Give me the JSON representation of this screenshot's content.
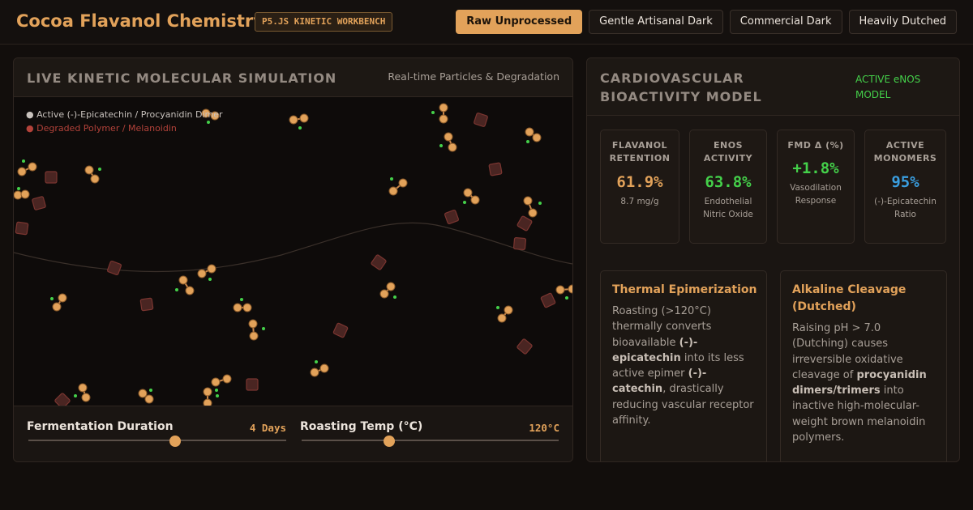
{
  "header": {
    "title": "Cocoa Flavanol Chemistry",
    "badge": "P5.JS KINETIC WORKBENCH",
    "presets": [
      {
        "label": "Raw Unprocessed",
        "active": true
      },
      {
        "label": "Gentle Artisanal Dark",
        "active": false
      },
      {
        "label": "Commercial Dark",
        "active": false
      },
      {
        "label": "Heavily Dutched",
        "active": false
      }
    ]
  },
  "simulation": {
    "title": "LIVE KINETIC MOLECULAR SIMULATION",
    "subtitle": "Real-time Particles & Degradation",
    "legend": {
      "active": "● Active (-)-Epicatechin / Procyanidin Dimer",
      "degraded": "● Degraded Polymer / Melanoidin"
    },
    "colors": {
      "active": "#e2a25a",
      "degraded": "#7a3530",
      "hydroxyl": "#44d04a"
    }
  },
  "controls": {
    "fermentation": {
      "label": "Fermentation Duration",
      "value": "4 Days",
      "fraction": 0.57
    },
    "roasting": {
      "label": "Roasting Temp (°C)",
      "value": "120°C",
      "fraction": 0.34
    }
  },
  "bioactivity": {
    "title": "CARDIOVASCULAR BIOACTIVITY MODEL",
    "badge": "ACTIVE eNOS MODEL",
    "metrics": [
      {
        "label": "FLAVANOL RETENTION",
        "value": "61.9%",
        "sub": "8.7 mg/g",
        "color": "#e2a25a"
      },
      {
        "label": "ENOS ACTIVITY",
        "value": "63.8%",
        "sub": "Endothelial Nitric Oxide",
        "color": "#44d04a"
      },
      {
        "label": "FMD Δ (%)",
        "value": "+1.8%",
        "sub": "Vasodilation Response",
        "color": "#44d04a"
      },
      {
        "label": "ACTIVE MONOMERS",
        "value": "95%",
        "sub": "(-)-Epicatechin Ratio",
        "color": "#3a9ee0"
      }
    ],
    "cards": [
      {
        "title": "Thermal Epimerization",
        "body": [
          {
            "t": "Roasting (>120°C) thermally converts bioavailable ",
            "b": false
          },
          {
            "t": "(-)-epicatechin",
            "b": true
          },
          {
            "t": " into its less active epimer ",
            "b": false
          },
          {
            "t": "(-)-catechin",
            "b": true
          },
          {
            "t": ", drastically reducing vascular receptor affinity.",
            "b": false
          }
        ]
      },
      {
        "title": "Alkaline Cleavage (Dutched)",
        "body": [
          {
            "t": "Raising pH > 7.0 (Dutching) causes irreversible oxidative cleavage of ",
            "b": false
          },
          {
            "t": "procyanidin dimers/trimers",
            "b": true
          },
          {
            "t": " into inactive high-molecular-weight brown melanoidin polymers.",
            "b": false
          }
        ]
      }
    ]
  }
}
